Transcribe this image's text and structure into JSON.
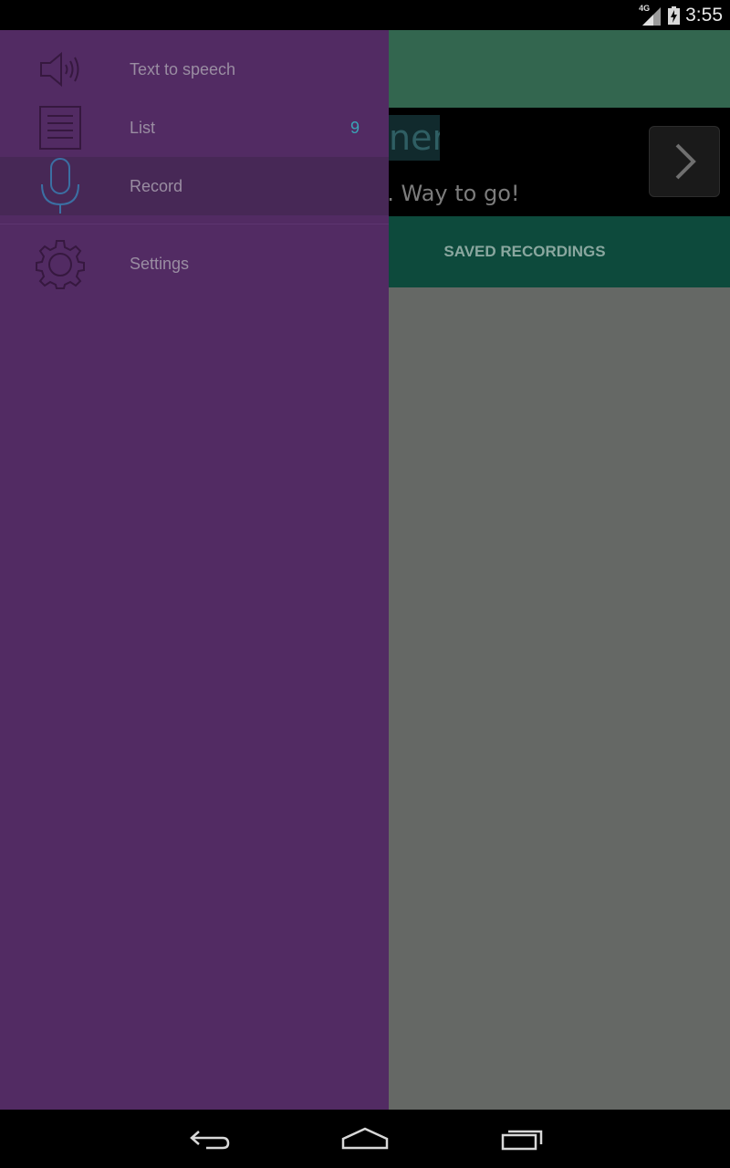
{
  "status_bar": {
    "time": "3:55",
    "network": "4G",
    "icons": [
      "signal-icon",
      "battery-icon"
    ]
  },
  "background_app": {
    "banner_title_partial": "ner",
    "banner_subtitle_partial": "o. Way to go!",
    "tabs": [
      {
        "label": "SAVED RECORDINGS"
      }
    ],
    "next_icon": "chevron-right-icon"
  },
  "drawer": {
    "items": [
      {
        "label": "Text to speech",
        "icon": "speaker-icon",
        "count": ""
      },
      {
        "label": "List",
        "icon": "list-icon",
        "count": "9"
      },
      {
        "label": "Record",
        "icon": "microphone-icon",
        "count": "",
        "active": true
      },
      {
        "label": "Settings",
        "icon": "gear-icon",
        "count": ""
      }
    ],
    "colors": {
      "background": "#522b63",
      "active_background": "#472856",
      "label": "#9a8da2",
      "count": "#3aa3b6",
      "active_icon": "#3b6fa3"
    }
  },
  "nav_bar": {
    "buttons": [
      "back-icon",
      "home-icon",
      "recent-apps-icon"
    ]
  }
}
